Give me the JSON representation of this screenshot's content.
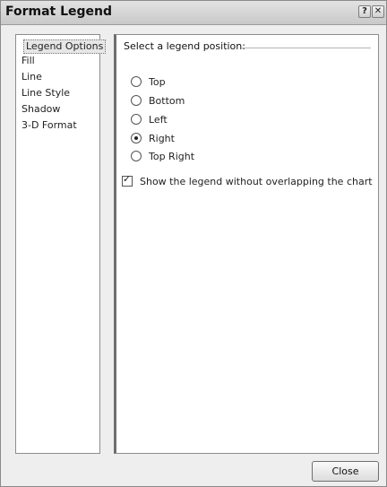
{
  "window": {
    "title": "Format Legend",
    "help_label": "?",
    "close_label": "✕"
  },
  "nav": {
    "items": [
      {
        "label": "Legend Options",
        "selected": true
      },
      {
        "label": "Fill",
        "selected": false
      },
      {
        "label": "Line",
        "selected": false
      },
      {
        "label": "Line Style",
        "selected": false
      },
      {
        "label": "Shadow",
        "selected": false
      },
      {
        "label": "3-D Format",
        "selected": false
      }
    ]
  },
  "legend_options": {
    "heading": "Select a legend position:",
    "positions": [
      {
        "label": "Top",
        "selected": false
      },
      {
        "label": "Bottom",
        "selected": false
      },
      {
        "label": "Left",
        "selected": false
      },
      {
        "label": "Right",
        "selected": true
      },
      {
        "label": "Top Right",
        "selected": false
      }
    ],
    "no_overlap_label": "Show the legend without overlapping the chart",
    "no_overlap_checked": true,
    "checkmark": "✓"
  },
  "footer": {
    "close_label": "Close"
  }
}
